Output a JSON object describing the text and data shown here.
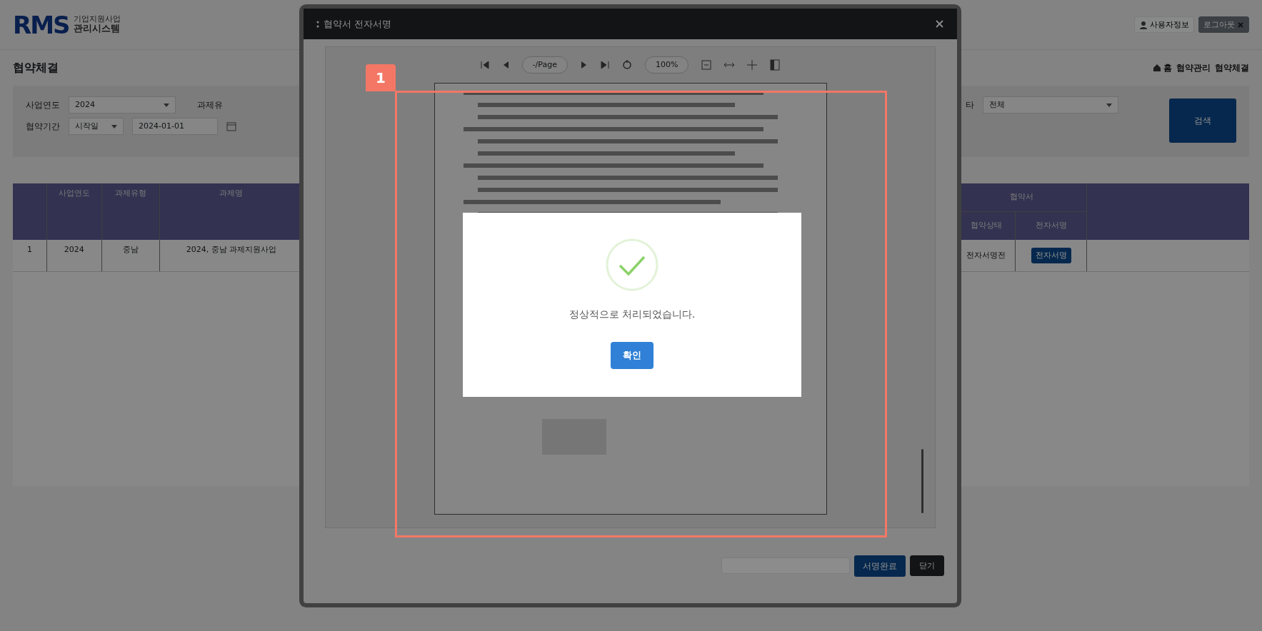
{
  "header": {
    "logo": "RMS",
    "logo_tagline": "기업지원사업",
    "logo_subtitle": "관리시스템",
    "user_button": "사용자정보",
    "logout_button": "로그아웃"
  },
  "page_title": "협약체결",
  "breadcrumb": [
    "홈",
    "협약관리",
    "협약체결"
  ],
  "filters": {
    "business_year": {
      "label": "사업연도",
      "value": "2024"
    },
    "task_type": {
      "label": "과제유"
    },
    "period": {
      "label": "협약기간",
      "type_value": "시작일",
      "date": "2024-01-01"
    },
    "status": {
      "label": "타",
      "value": "전체"
    },
    "search_button": "검색"
  },
  "table": {
    "columns_left": [
      "사업연도",
      "과제유형",
      "과제명"
    ],
    "group_header": "협약서",
    "sub_columns": [
      "협약상태",
      "전자서명"
    ],
    "rows": [
      {
        "number": "1",
        "year": "2024",
        "type": "중남",
        "title": "2024, 중남 과제지원사업",
        "status": "전자서명전",
        "action": "전자서명"
      }
    ]
  },
  "modal": {
    "title": "협약서 전자서명",
    "viewer": {
      "page_select": "-/Page",
      "zoom_select": "100%"
    },
    "sign_complete_button": "서명완료",
    "close_button": "닫기"
  },
  "alert": {
    "message": "정상적으로 처리되었습니다.",
    "confirm_button": "확인"
  },
  "annotation": {
    "label": "1"
  }
}
